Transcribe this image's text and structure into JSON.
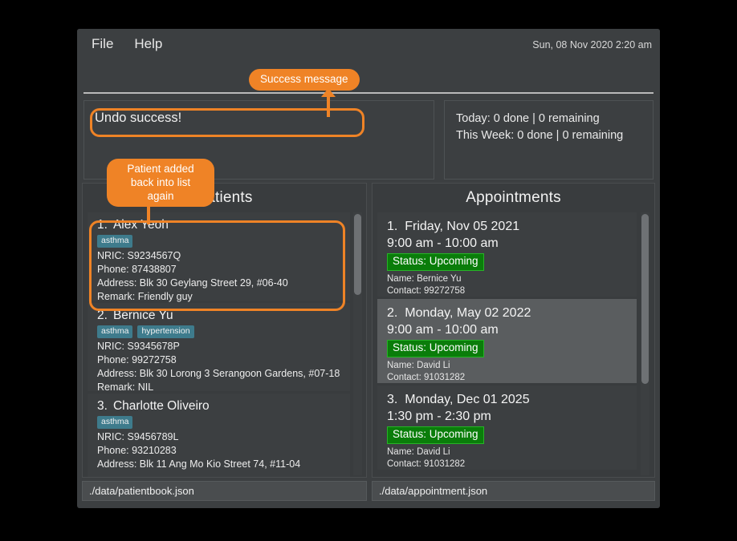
{
  "window": {
    "menu": [
      {
        "label": "File",
        "name": "menu-file"
      },
      {
        "label": "Help",
        "name": "menu-help"
      }
    ],
    "clock": "Sun, 08 Nov 2020 2:20 am"
  },
  "result_box": {
    "message": "Undo success!"
  },
  "stats": {
    "today": "Today: 0 done | 0 remaining",
    "this_week": "This Week: 0 done | 0 remaining"
  },
  "patients_panel": {
    "title": "Patients",
    "status_path": "./data/patientbook.json",
    "cards": [
      {
        "index": "1.",
        "name": "Alex Yeoh",
        "tags": [
          "asthma"
        ],
        "nric": "NRIC: S9234567Q",
        "phone": "Phone: 87438807",
        "address": "Address: Blk 30 Geylang Street 29, #06-40",
        "remark": "Remark: Friendly guy"
      },
      {
        "index": "2.",
        "name": "Bernice Yu",
        "tags": [
          "asthma",
          "hypertension"
        ],
        "nric": "NRIC: S9345678P",
        "phone": "Phone: 99272758",
        "address": "Address: Blk 30 Lorong 3 Serangoon Gardens, #07-18",
        "remark": "Remark: NIL"
      },
      {
        "index": "3.",
        "name": "Charlotte Oliveiro",
        "tags": [
          "asthma"
        ],
        "nric": "NRIC: S9456789L",
        "phone": "Phone: 93210283",
        "address": "Address: Blk 11 Ang Mo Kio Street 74, #11-04",
        "remark": ""
      }
    ]
  },
  "appointments_panel": {
    "title": "Appointments",
    "status_path": "./data/appointment.json",
    "cards": [
      {
        "index": "1.",
        "date": "Friday, Nov 05 2021",
        "time": "9:00 am - 10:00 am",
        "status": "Status: Upcoming",
        "name": "Name: Bernice Yu",
        "contact": "Contact: 99272758",
        "selected": false
      },
      {
        "index": "2.",
        "date": "Monday, May 02 2022",
        "time": "9:00 am - 10:00 am",
        "status": "Status: Upcoming",
        "name": "Name: David Li",
        "contact": "Contact: 91031282",
        "selected": true
      },
      {
        "index": "3.",
        "date": "Monday, Dec 01 2025",
        "time": "1:30 pm - 2:30 pm",
        "status": "Status: Upcoming",
        "name": "Name: David Li",
        "contact": "Contact: 91031282",
        "selected": false
      }
    ]
  },
  "annotations": {
    "success_message": "Success message",
    "patient_added": "Patient added back into list again"
  },
  "colors": {
    "accent_orange": "#ef8326",
    "tag_teal": "#3e7b8c",
    "status_green": "#0a7d0a",
    "window_bg": "#3c3f41",
    "panel_bg": "#393c3e",
    "card_selected": "#5a5d5f"
  }
}
